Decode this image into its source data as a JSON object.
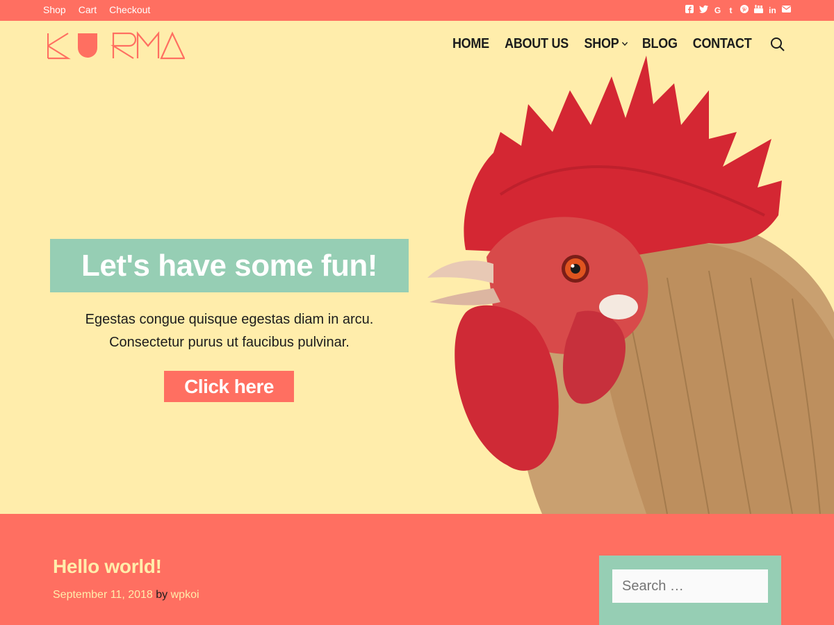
{
  "topbar": {
    "links": [
      "Shop",
      "Cart",
      "Checkout"
    ],
    "social_icons": [
      "facebook-icon",
      "twitter-icon",
      "google-plus-icon",
      "tumblr-icon",
      "pinterest-icon",
      "youtube-icon",
      "linkedin-icon",
      "email-icon"
    ],
    "bg_color": "#ff6f61"
  },
  "header": {
    "logo_text": "KURMA",
    "nav": [
      "HOME",
      "ABOUT US",
      "SHOP",
      "BLOG",
      "CONTACT"
    ]
  },
  "hero": {
    "title": "Let's have some fun!",
    "subtitle_line1": "Egestas congue quisque egestas diam in arcu.",
    "subtitle_line2": "Consectetur purus ut faucibus pulvinar.",
    "cta": "Click here",
    "bg_color": "#ffedab",
    "title_box_color": "#96ceb4"
  },
  "post": {
    "title": "Hello world!",
    "date": "September 11, 2018",
    "by": "by",
    "author": "wpkoi"
  },
  "sidebar": {
    "search_placeholder": "Search …"
  }
}
